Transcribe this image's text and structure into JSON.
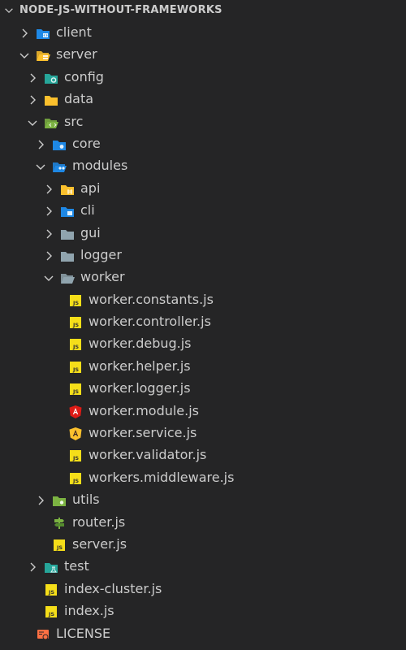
{
  "explorer": {
    "section_title": "NODE-JS-WITHOUT-FRAMEWORKS",
    "tree": [
      {
        "label": "client",
        "icon": "client-folder-icon",
        "depth": 0,
        "state": "collapsed"
      },
      {
        "label": "server",
        "icon": "server-folder-open-icon",
        "depth": 0,
        "state": "expanded"
      },
      {
        "label": "config",
        "icon": "config-folder-icon",
        "depth": 1,
        "state": "collapsed"
      },
      {
        "label": "data",
        "icon": "folder-icon",
        "depth": 1,
        "state": "collapsed"
      },
      {
        "label": "src",
        "icon": "src-folder-open-icon",
        "depth": 1,
        "state": "expanded"
      },
      {
        "label": "core",
        "icon": "core-folder-icon",
        "depth": 2,
        "state": "collapsed"
      },
      {
        "label": "modules",
        "icon": "modules-folder-open-icon",
        "depth": 2,
        "state": "expanded"
      },
      {
        "label": "api",
        "icon": "api-folder-icon",
        "depth": 3,
        "state": "collapsed"
      },
      {
        "label": "cli",
        "icon": "cli-folder-icon",
        "depth": 3,
        "state": "collapsed"
      },
      {
        "label": "gui",
        "icon": "gray-folder-icon",
        "depth": 3,
        "state": "collapsed"
      },
      {
        "label": "logger",
        "icon": "gray-folder-icon",
        "depth": 3,
        "state": "collapsed"
      },
      {
        "label": "worker",
        "icon": "gray-folder-open-icon",
        "depth": 3,
        "state": "expanded"
      },
      {
        "label": "worker.constants.js",
        "icon": "js-file-icon",
        "depth": 4,
        "state": "file"
      },
      {
        "label": "worker.controller.js",
        "icon": "js-file-icon",
        "depth": 4,
        "state": "file"
      },
      {
        "label": "worker.debug.js",
        "icon": "js-file-icon",
        "depth": 4,
        "state": "file"
      },
      {
        "label": "worker.helper.js",
        "icon": "js-file-icon",
        "depth": 4,
        "state": "file"
      },
      {
        "label": "worker.logger.js",
        "icon": "js-file-icon",
        "depth": 4,
        "state": "file"
      },
      {
        "label": "worker.module.js",
        "icon": "angular-module-icon",
        "depth": 4,
        "state": "file"
      },
      {
        "label": "worker.service.js",
        "icon": "angular-service-icon",
        "depth": 4,
        "state": "file"
      },
      {
        "label": "worker.validator.js",
        "icon": "js-file-icon",
        "depth": 4,
        "state": "file"
      },
      {
        "label": "workers.middleware.js",
        "icon": "js-file-icon",
        "depth": 4,
        "state": "file"
      },
      {
        "label": "utils",
        "icon": "utils-folder-icon",
        "depth": 2,
        "state": "collapsed"
      },
      {
        "label": "router.js",
        "icon": "router-icon",
        "depth": 2,
        "state": "file"
      },
      {
        "label": "server.js",
        "icon": "js-file-icon",
        "depth": 2,
        "state": "file"
      },
      {
        "label": "test",
        "icon": "test-folder-icon",
        "depth": 1,
        "state": "collapsed"
      },
      {
        "label": "index-cluster.js",
        "icon": "js-file-icon",
        "depth": 1,
        "state": "file"
      },
      {
        "label": "index.js",
        "icon": "js-file-icon",
        "depth": 1,
        "state": "file"
      },
      {
        "label": "LICENSE",
        "icon": "license-icon",
        "depth": 0,
        "state": "file"
      }
    ]
  },
  "colors": {
    "background": "#252526",
    "text": "#cccccc",
    "js_yellow": "#f5de19",
    "angular_red": "#dd1b16",
    "folder_blue": "#1e88e5",
    "folder_teal": "#26a69a",
    "folder_green": "#7cb342",
    "folder_yellow": "#fbc02d",
    "folder_gray": "#90a4ae"
  }
}
